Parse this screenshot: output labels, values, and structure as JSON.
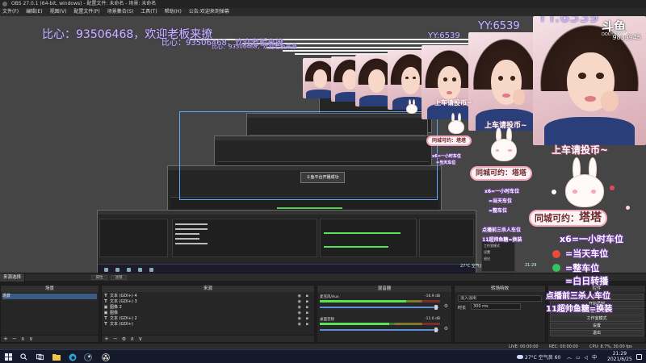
{
  "window": {
    "title": "OBS 27.0.1 (64-bit, windows) - 配置文件: 未命名 - 场景: 未命名"
  },
  "menu": {
    "items": [
      "文件(F)",
      "编辑(E)",
      "视图(V)",
      "配置文件(P)",
      "场景集合(S)",
      "工具(T)",
      "帮助(H)",
      "公告:欢迎来到弹幕"
    ]
  },
  "preview": {
    "watermark_main": "比心：93506468，欢迎老板来撩",
    "watermark_small": "比心：93506468，欢迎老板来撩",
    "room_id": "YY:6539",
    "room_id_full": "YY:6539",
    "douyu_brand": "斗鱼",
    "douyu_site": "DOUYU.COM",
    "douyu_id": "9833945",
    "card_title": "上车请投币~",
    "promo_pill": "同城可约：",
    "streamer_name": "塔塔",
    "price_lines": [
      "x6=一小时车位",
      "=当天车位",
      "=整车位",
      "=白日转播",
      "点播前三杀人车位",
      "11超帅鱼糖=换装"
    ],
    "overlay_dialog": "斗鱼平台开播成功",
    "mini_controls": [
      "工作室模式",
      "设置",
      "退出"
    ],
    "mini_weather": "27°C 空气良 60",
    "mini_clock": "21:29"
  },
  "docks": {
    "scenes": {
      "title": "场景",
      "items": [
        "场景"
      ]
    },
    "sources": {
      "title": "来源",
      "items": [
        {
          "icon": "text",
          "label": "文本 (GDI+) 4"
        },
        {
          "icon": "text",
          "label": "文本 (GDI+) 3"
        },
        {
          "icon": "image",
          "label": "图像 2"
        },
        {
          "icon": "image",
          "label": "图像"
        },
        {
          "icon": "text",
          "label": "文本 (GDI+) 2"
        },
        {
          "icon": "text",
          "label": "文本 (GDI+)"
        }
      ]
    },
    "mixer": {
      "title": "混音器",
      "channels": [
        {
          "name": "麦克风/Aux",
          "db": "-16.9 dB",
          "level": 0.72
        },
        {
          "name": "桌面音频",
          "db": "-11.0 dB",
          "level": 0.58
        }
      ]
    },
    "transitions": {
      "title": "转场特效",
      "type": "淡入淡出",
      "duration_label": "时长",
      "duration_value": "300 ms"
    },
    "controls": {
      "title": "控件",
      "buttons": [
        "开始推流",
        "开始录制",
        "启动虚拟摄像机",
        "工作室模式",
        "设置",
        "退出"
      ]
    },
    "scene_tab": "来源选择",
    "mini_tabs": [
      "属性",
      "滤镜"
    ]
  },
  "tool_glyphs": [
    "+",
    "−",
    "∧",
    "∨"
  ],
  "status": {
    "live": "LIVE: 00:00:00",
    "rec": "REC: 00:00:00",
    "cpu": "CPU: 8.7%, 30.00 fps"
  },
  "taskbar": {
    "weather": "27°C 空气良 60",
    "time": "21:29",
    "date": "2021/6/25",
    "lang": "中"
  },
  "colors": {
    "accent": "#3d5a85",
    "watermark": "#c9b8ff",
    "meter_green": "#57e557",
    "slider_blue": "#5c8fdc",
    "card_pink": "#f2a7bd"
  }
}
